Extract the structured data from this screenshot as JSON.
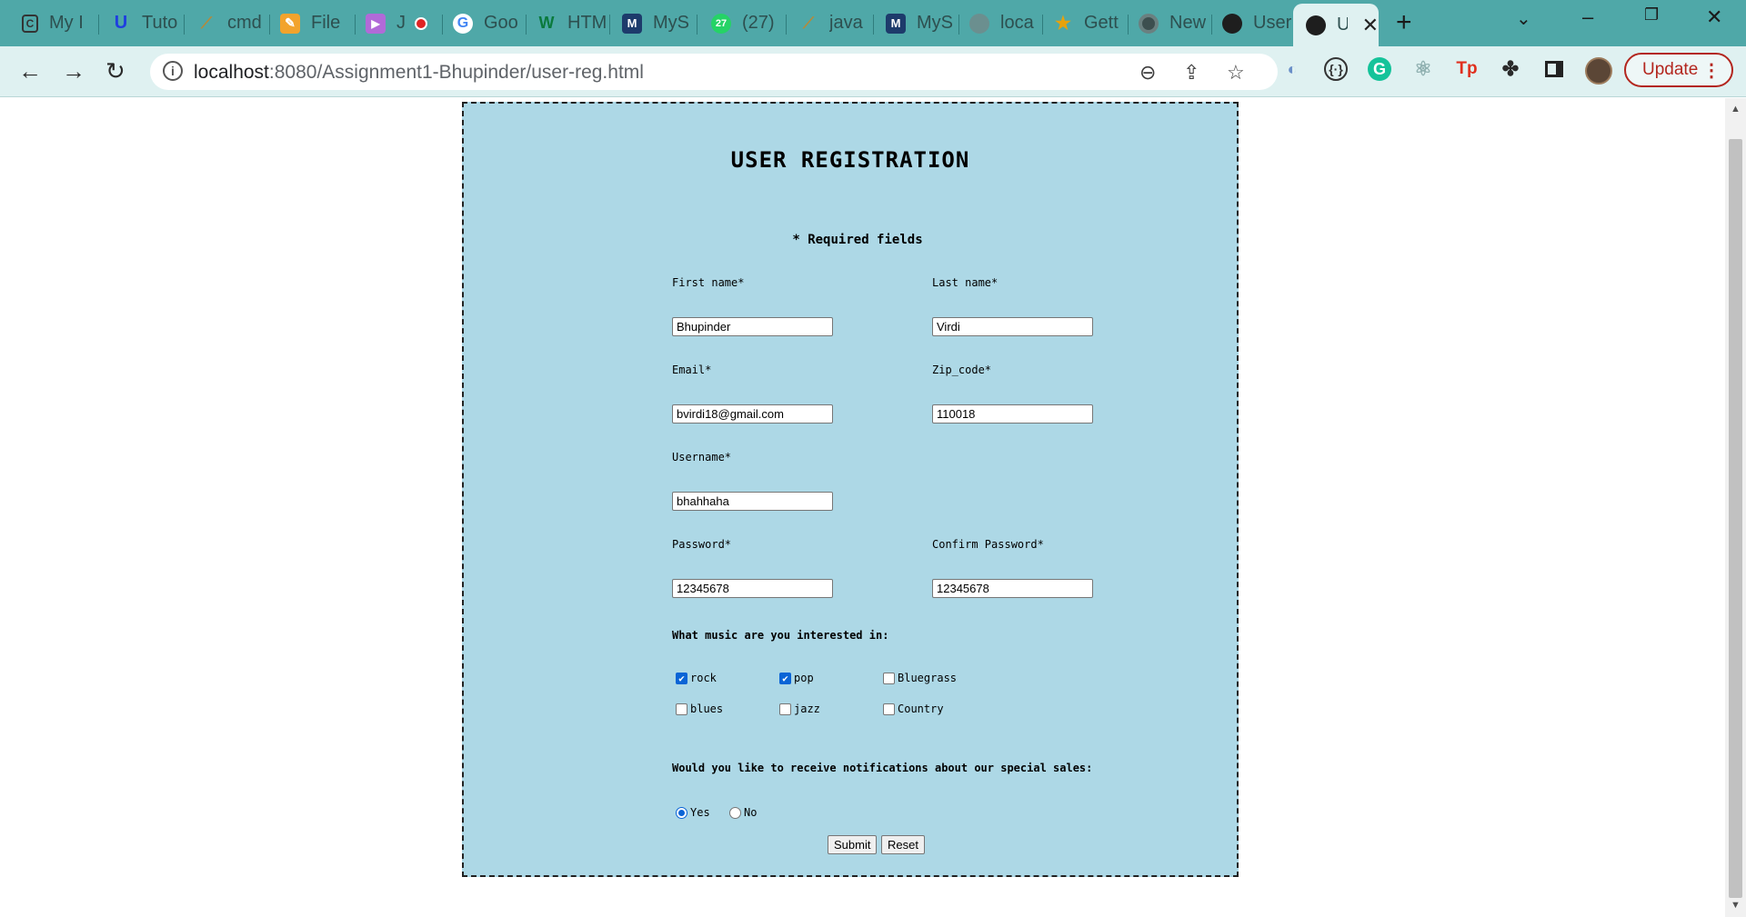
{
  "browser": {
    "tabs": [
      {
        "title": "My I",
        "icon": "document-icon"
      },
      {
        "title": "Tuto",
        "icon": "u-logo-icon"
      },
      {
        "title": "cmd",
        "icon": "feather-icon"
      },
      {
        "title": "File",
        "icon": "pencil-icon"
      },
      {
        "title": "J",
        "icon": "play-icon"
      },
      {
        "title": "Goo",
        "icon": "google-icon"
      },
      {
        "title": "HTM",
        "icon": "w3schools-icon"
      },
      {
        "title": "MyS",
        "icon": "mysql-icon"
      },
      {
        "title": "(27)",
        "icon": "whatsapp-icon"
      },
      {
        "title": "java",
        "icon": "feather-icon"
      },
      {
        "title": "MyS",
        "icon": "mysql-icon"
      },
      {
        "title": "loca",
        "icon": "globe-icon"
      },
      {
        "title": "Gett",
        "icon": "star-icon"
      },
      {
        "title": "New",
        "icon": "chrome-icon"
      },
      {
        "title": "User",
        "icon": "globe-icon"
      },
      {
        "title": "U",
        "icon": "globe-icon"
      }
    ],
    "url_host": "localhost",
    "url_path": ":8080/Assignment1-Bhupinder/user-reg.html",
    "update_label": "Update"
  },
  "form": {
    "title": "USER REGISTRATION",
    "required_note": "* Required fields",
    "first_name_label": "First name*",
    "first_name_value": "Bhupinder",
    "last_name_label": "Last name*",
    "last_name_value": "Virdi",
    "email_label": "Email*",
    "email_value": "bvirdi18@gmail.com",
    "zip_label": "Zip_code*",
    "zip_value": "110018",
    "username_label": "Username*",
    "username_value": "bhahhaha",
    "password_label": "Password*",
    "password_value": "12345678",
    "confirm_password_label": "Confirm Password*",
    "confirm_password_value": "12345678",
    "music_question": "What music are you interested in:",
    "music": [
      {
        "label": "rock",
        "checked": true
      },
      {
        "label": "pop",
        "checked": true
      },
      {
        "label": "Bluegrass",
        "checked": false
      },
      {
        "label": "blues",
        "checked": false
      },
      {
        "label": "jazz",
        "checked": false
      },
      {
        "label": "Country",
        "checked": false
      }
    ],
    "notify_question": "Would you like to receive notifications about our special sales:",
    "notify_yes": "Yes",
    "notify_no": "No",
    "notify_selected": "Yes",
    "submit_label": "Submit",
    "reset_label": "Reset"
  }
}
